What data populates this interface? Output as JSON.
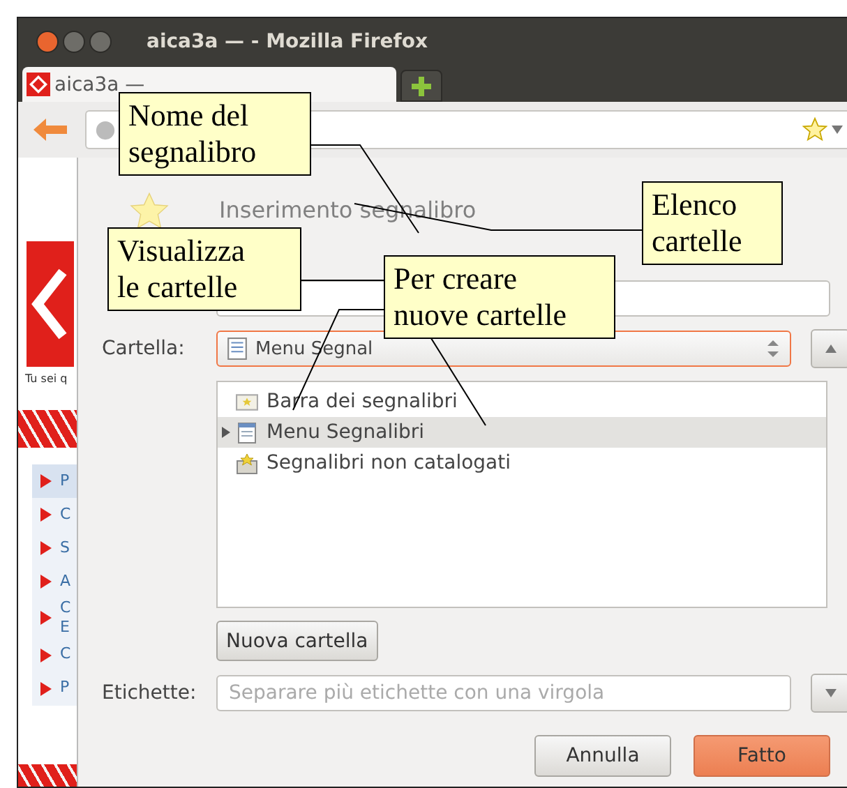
{
  "window": {
    "title": "aica3a — - Mozilla Firefox"
  },
  "tabs": [
    {
      "label": "aica3a —",
      "selected": true
    }
  ],
  "page": {
    "caption": "Tu sei q",
    "sidebar_items": [
      {
        "text": "P",
        "selected": true
      },
      {
        "text": "C",
        "selected": false
      },
      {
        "text": "S",
        "selected": false
      },
      {
        "text": "A",
        "selected": false
      },
      {
        "text": "C\nE",
        "selected": false
      },
      {
        "text": "C",
        "selected": false
      },
      {
        "text": "P",
        "selected": false
      }
    ]
  },
  "dialog": {
    "title": "Inserimento segnalibro",
    "folder_label": "Cartella:",
    "folder_value": "Menu Segnal",
    "folders": [
      {
        "label": "Barra dei segnalibri",
        "kind": "toolbar",
        "expandable": false,
        "selected": false
      },
      {
        "label": "Menu Segnalibri",
        "kind": "menu",
        "expandable": true,
        "selected": true
      },
      {
        "label": "Segnalibri non catalogati",
        "kind": "unsorted",
        "expandable": false,
        "selected": false
      }
    ],
    "new_folder_button": "Nuova cartella",
    "tags_label": "Etichette:",
    "tags_placeholder": "Separare più etichette con una virgola",
    "buttons": [
      {
        "label": "Annulla",
        "kind": "secondary"
      },
      {
        "label": "Fatto",
        "kind": "primary"
      }
    ]
  },
  "callouts": [
    {
      "text": "Nome del\nsegnalibro"
    },
    {
      "text": "Elenco\ncartelle"
    },
    {
      "text": "Visualizza\nle cartelle"
    },
    {
      "text": "Per creare\nnuove cartelle"
    }
  ]
}
